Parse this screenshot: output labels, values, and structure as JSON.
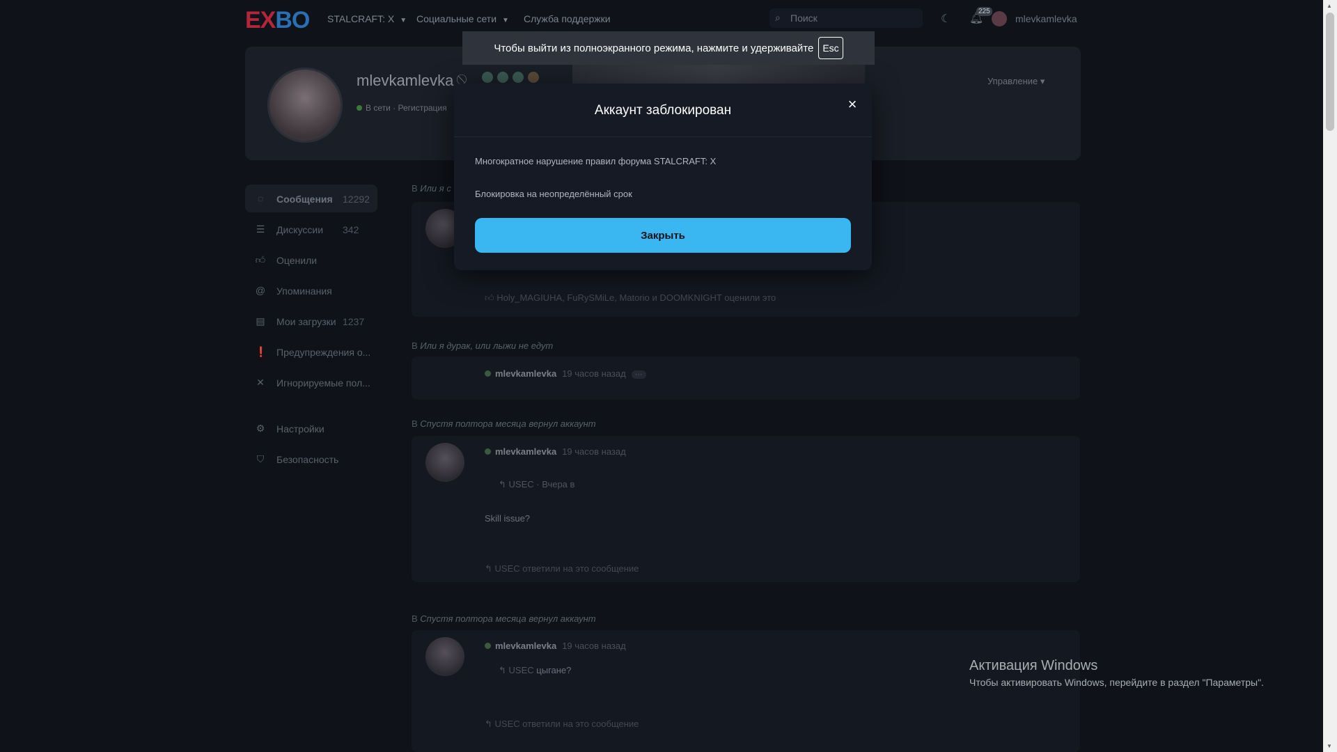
{
  "topbar": {
    "logo_ex": "EX",
    "logo_bo": "BO",
    "nav": [
      "STALCRAFT: X",
      "Социальные сети",
      "Служба поддержки"
    ],
    "search_placeholder": "Поиск",
    "notification_count": "225",
    "username": "mlevkamlevka"
  },
  "profile": {
    "name": "mlevkamlevka",
    "status_text": "В сети · Регистрация",
    "manage_label": "Управление"
  },
  "sidebar": {
    "items": [
      {
        "label": "Сообщения",
        "count": "12292",
        "icon": "comment-icon"
      },
      {
        "label": "Дискуссии",
        "count": "342",
        "icon": "list-icon"
      },
      {
        "label": "Оценили",
        "count": "",
        "icon": "thumbs-up-icon"
      },
      {
        "label": "Упоминания",
        "count": "",
        "icon": "at-icon"
      },
      {
        "label": "Мои загрузки",
        "count": "1237",
        "icon": "file-icon"
      },
      {
        "label": "Предупреждения о...",
        "count": "",
        "icon": "warning-icon"
      },
      {
        "label": "Игнорируемые пол...",
        "count": "",
        "icon": "ignore-icon"
      },
      {
        "label": "Настройки",
        "count": "",
        "icon": "gear-icon"
      },
      {
        "label": "Безопасность",
        "count": "",
        "icon": "shield-icon"
      }
    ]
  },
  "feed": {
    "thread1_title_prefix": "В",
    "thread1_title": "Или я с",
    "post1_footer": "Holy_MAGIUHA, FuRySMiLe, Matorio и DOOMKNIGHT оценили это",
    "thread2_title_prefix": "В",
    "thread2_title": "Или я дурак, или лыжи не едут",
    "post2_author": "mlevkamlevka",
    "post2_time": "19 часов назад",
    "thread3_title_prefix": "В",
    "thread3_title": "Спустя полтора месяца вернул аккаунт",
    "post3_author": "mlevkamlevka",
    "post3_time": "19 часов назад",
    "post3_quote": "USEC · Вчера в",
    "post3_text": "Skill issue?",
    "post3_footer": "USEC ответили на это сообщение",
    "thread4_title_prefix": "В",
    "thread4_title": "Спустя полтора месяца вернул аккаунт",
    "post4_author": "mlevkamlevka",
    "post4_time": "19 часов назад",
    "post4_quote_user": "USEC",
    "post4_quote_text": "цыгане?",
    "post4_footer": "USEC ответили на это сообщение"
  },
  "fullscreen_notice": {
    "text": "Чтобы выйти из полноэкранного режима, нажмите и удерживайте",
    "key": "Esc"
  },
  "modal": {
    "title": "Аккаунт заблокирован",
    "close_glyph": "×",
    "reason": "Многократное нарушение правил форума STALCRAFT: X",
    "duration": "Блокировка на неопределённый срок",
    "button_label": "Закрыть",
    "button_color": "#3ab7f0"
  },
  "windows_activation": {
    "title": "Активация Windows",
    "subtitle": "Чтобы активировать Windows, перейдите в раздел \"Параметры\"."
  }
}
